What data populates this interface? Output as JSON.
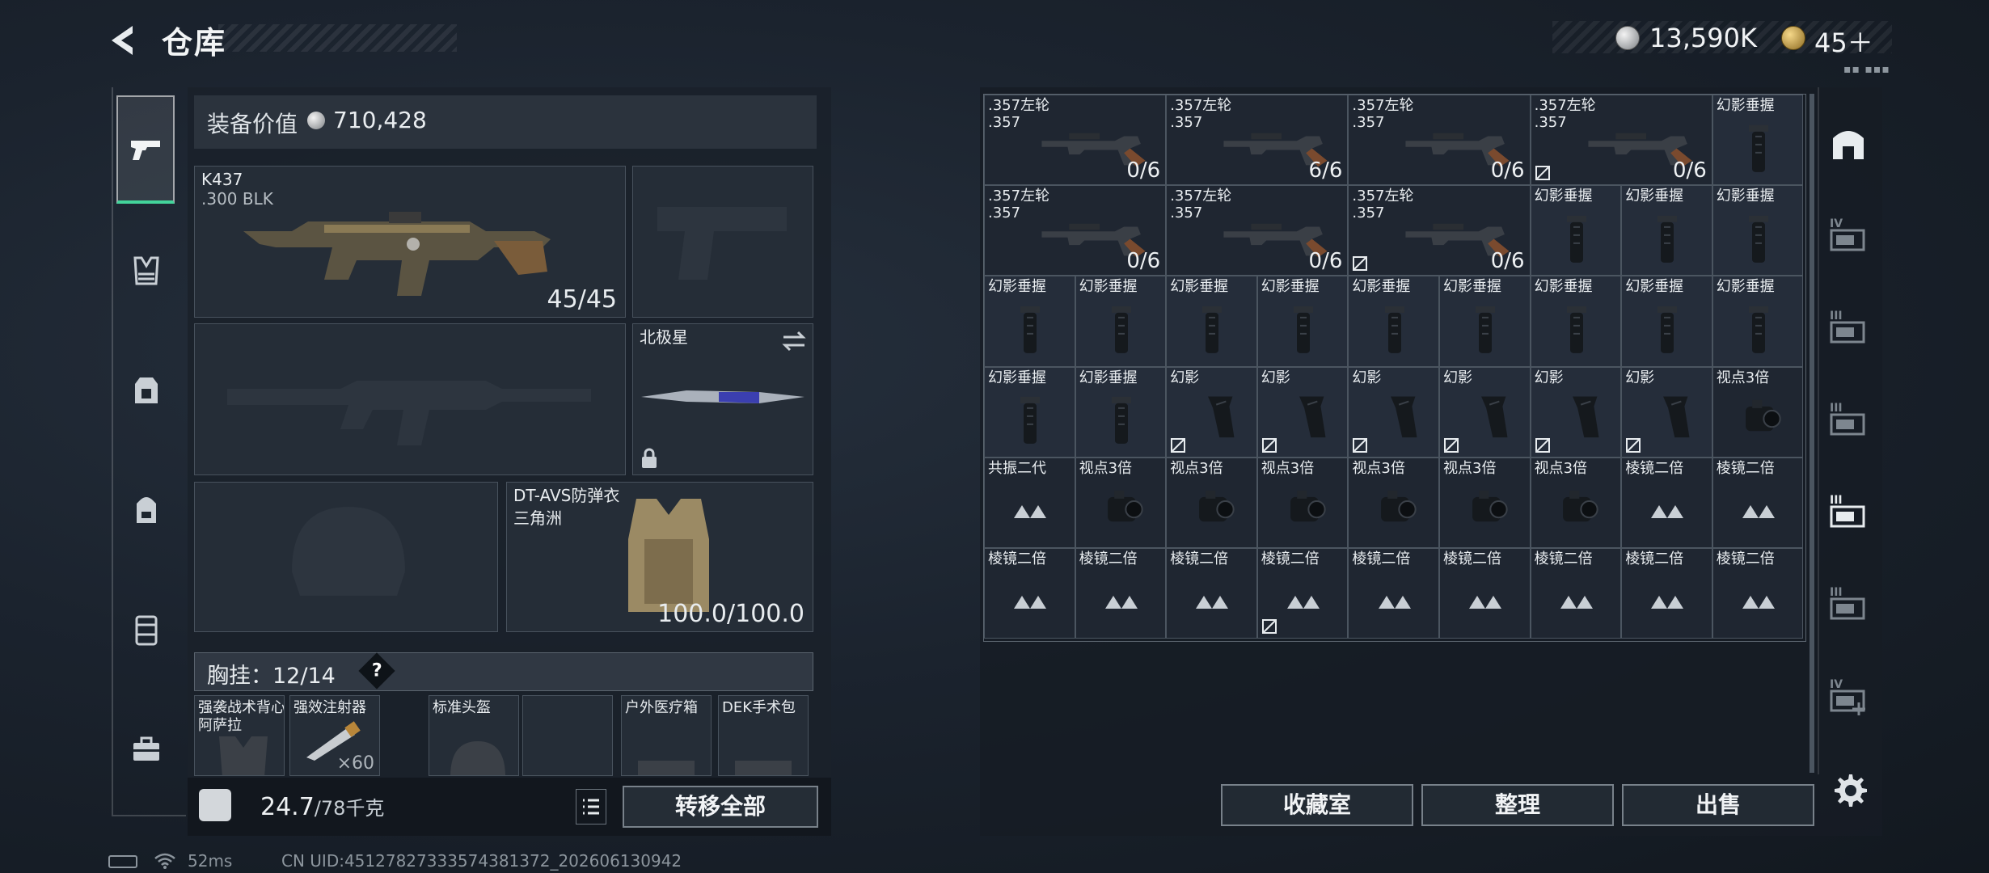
{
  "header": {
    "title": "仓库",
    "money": "13,590K",
    "tokens": "45＋",
    "version_mark": "▪▪ ▪▪▪"
  },
  "loadout": {
    "value_label": "装备价值",
    "value": "710,428",
    "primary": {
      "name": "K437",
      "caliber": ".300 BLK",
      "ammo": "45/45"
    },
    "melee": {
      "name": "北极星"
    },
    "armor": {
      "name": "DT-AVS防弹衣",
      "sub": "三角洲",
      "durability": "100.0/100.0"
    },
    "chest": {
      "label": "胸挂：12/14",
      "help": "?"
    },
    "pockets": [
      {
        "name": "强袭战术背心\n阿萨拉"
      },
      {
        "name": "强效注射器",
        "count": "×60"
      },
      {
        "name": "标准头盔"
      },
      {
        "name": ""
      },
      {
        "name": "户外医疗箱"
      },
      {
        "name": "DEK手术包"
      }
    ],
    "weight": "24.7",
    "weight_max": "/78千克",
    "transfer_all": "转移全部"
  },
  "stash": {
    "rows": [
      [
        {
          "label": ".357左轮\n.357",
          "count": "0/6",
          "type": "revolver"
        },
        {
          "label": ".357左轮\n.357",
          "count": "6/6",
          "type": "revolver"
        },
        {
          "label": ".357左轮\n.357",
          "count": "0/6",
          "type": "revolver"
        },
        {
          "label": ".357左轮\n.357",
          "count": "0/6",
          "type": "revolver",
          "flag": true
        },
        {
          "label": "幻影垂握",
          "type": "grip"
        }
      ],
      [
        {
          "label": ".357左轮\n.357",
          "count": "0/6",
          "type": "revolver"
        },
        {
          "label": ".357左轮\n.357",
          "count": "0/6",
          "type": "revolver"
        },
        {
          "label": ".357左轮\n.357",
          "count": "0/6",
          "type": "revolver",
          "flag": true
        },
        {
          "label": "幻影垂握",
          "type": "grip"
        },
        {
          "label": "幻影垂握",
          "type": "grip"
        },
        {
          "label": "幻影垂握",
          "type": "grip"
        }
      ],
      [
        {
          "label": "幻影垂握",
          "type": "grip"
        },
        {
          "label": "幻影垂握",
          "type": "grip"
        },
        {
          "label": "幻影垂握",
          "type": "grip"
        },
        {
          "label": "幻影垂握",
          "type": "grip"
        },
        {
          "label": "幻影垂握",
          "type": "grip"
        },
        {
          "label": "幻影垂握",
          "type": "grip"
        },
        {
          "label": "幻影垂握",
          "type": "grip"
        },
        {
          "label": "幻影垂握",
          "type": "grip"
        },
        {
          "label": "幻影垂握",
          "type": "grip"
        }
      ],
      [
        {
          "label": "幻影垂握",
          "type": "grip"
        },
        {
          "label": "幻影垂握",
          "type": "grip"
        },
        {
          "label": "幻影",
          "type": "pistolgrip",
          "flag": true
        },
        {
          "label": "幻影",
          "type": "pistolgrip",
          "flag": true
        },
        {
          "label": "幻影",
          "type": "pistolgrip",
          "flag": true
        },
        {
          "label": "幻影",
          "type": "pistolgrip",
          "flag": true
        },
        {
          "label": "幻影",
          "type": "pistolgrip",
          "flag": true
        },
        {
          "label": "幻影",
          "type": "pistolgrip",
          "flag": true
        },
        {
          "label": "视点3倍",
          "type": "scope"
        }
      ],
      [
        {
          "label": "共振二代",
          "type": "prism"
        },
        {
          "label": "视点3倍",
          "type": "scope"
        },
        {
          "label": "视点3倍",
          "type": "scope"
        },
        {
          "label": "视点3倍",
          "type": "scope"
        },
        {
          "label": "视点3倍",
          "type": "scope"
        },
        {
          "label": "视点3倍",
          "type": "scope"
        },
        {
          "label": "视点3倍",
          "type": "scope"
        },
        {
          "label": "棱镜二倍",
          "type": "prism"
        },
        {
          "label": "棱镜二倍",
          "type": "prism"
        }
      ],
      [
        {
          "label": "棱镜二倍",
          "type": "prism"
        },
        {
          "label": "棱镜二倍",
          "type": "prism"
        },
        {
          "label": "棱镜二倍",
          "type": "prism"
        },
        {
          "label": "棱镜二倍",
          "type": "prism",
          "flag": true
        },
        {
          "label": "棱镜二倍",
          "type": "prism"
        },
        {
          "label": "棱镜二倍",
          "type": "prism"
        },
        {
          "label": "棱镜二倍",
          "type": "prism"
        },
        {
          "label": "棱镜二倍",
          "type": "prism"
        },
        {
          "label": "棱镜二倍",
          "type": "prism"
        }
      ]
    ],
    "tabs": [
      {
        "icon": "home-tab-icon",
        "mark": ""
      },
      {
        "icon": "folder-tab-icon",
        "mark": "IV"
      },
      {
        "icon": "storage-tab-icon",
        "mark": "III"
      },
      {
        "icon": "storage-tab-icon",
        "mark": "III"
      },
      {
        "icon": "storage-tab-icon",
        "mark": "III"
      },
      {
        "icon": "storage-tab-icon",
        "mark": "III"
      },
      {
        "icon": "add-storage-tab-icon",
        "mark": "IV"
      }
    ],
    "buttons": {
      "collection": "收藏室",
      "organize": "整理",
      "sell": "出售"
    }
  },
  "status": {
    "ping": "52ms",
    "uid": "CN UID:4512782733357438137​2_202606130942"
  }
}
